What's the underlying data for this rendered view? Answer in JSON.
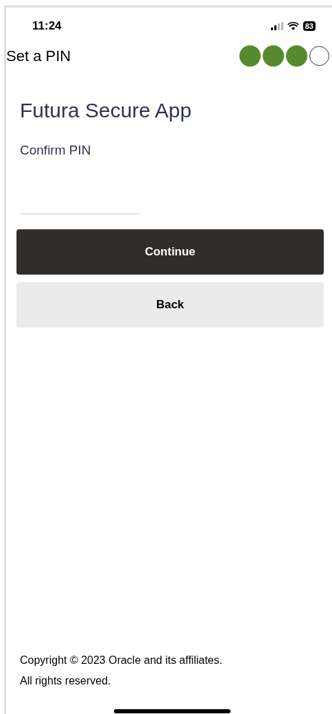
{
  "status_bar": {
    "time": "11:24",
    "battery": "83"
  },
  "header": {
    "title": "Set a PIN",
    "steps": [
      {
        "done": true
      },
      {
        "done": true
      },
      {
        "done": true
      },
      {
        "done": false
      }
    ]
  },
  "app_title": "Futura Secure App",
  "pin_field": {
    "label": "Confirm PIN"
  },
  "buttons": [
    {
      "label": "Continue",
      "kind": "primary"
    },
    {
      "label": "Back",
      "kind": "secondary"
    }
  ],
  "footer": [
    "Copyright © 2023 Oracle and its affiliates.",
    "All rights reserved."
  ]
}
